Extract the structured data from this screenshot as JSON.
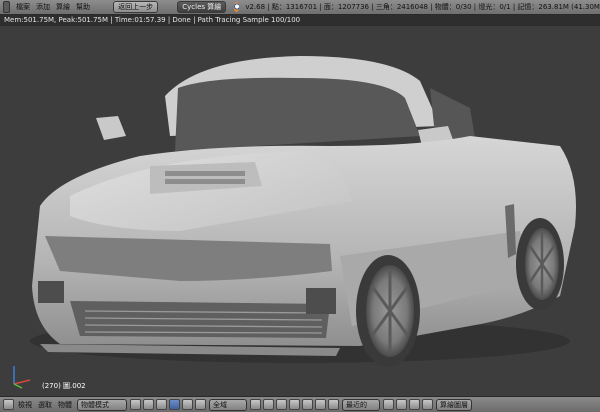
{
  "topbar": {
    "menu": [
      "檔案",
      "添加",
      "算繪",
      "幫助"
    ],
    "undo_label": "返回上一步",
    "engine": "Cycles 算繪",
    "stats": "v2.68 | 點：1316701 | 面：1207736 | 三角：2416048 | 物體：0/30 | 燈光：0/1 | 記憶：263.81M (41.30M"
  },
  "render_status": "Mem:501.75M, Peak:501.75M | Time:01:57.39 | Done | Path Tracing Sample 100/100",
  "viewport": {
    "frame_label": "(270) 圖.002"
  },
  "bottombar": {
    "menus": [
      "檢視",
      "選取",
      "物體"
    ],
    "mode": "物體模式",
    "pivot": "全域",
    "snap": "最近的",
    "render_button": "算繪圖層"
  }
}
